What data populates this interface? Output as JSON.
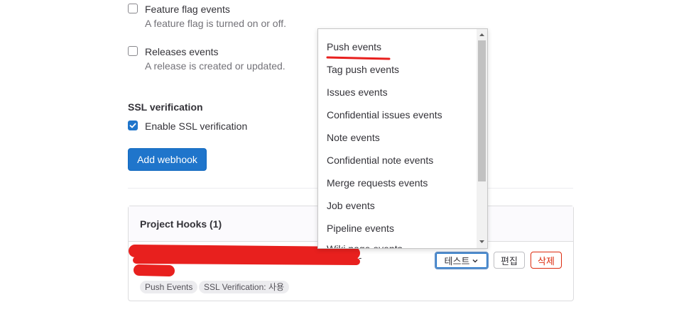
{
  "form": {
    "feature_flag": {
      "label": "Feature flag events",
      "help": "A feature flag is turned on or off.",
      "checked": false
    },
    "releases": {
      "label": "Releases events",
      "help": "A release is created or updated.",
      "checked": false
    },
    "ssl": {
      "title": "SSL verification",
      "label": "Enable SSL verification",
      "checked": true
    },
    "add_webhook_label": "Add webhook"
  },
  "hooks": {
    "header": "Project Hooks (1)",
    "row": {
      "url_suffix": "-",
      "badges": [
        "Push Events",
        "SSL Verification: 사용"
      ],
      "test_label": "테스트",
      "edit_label": "편집",
      "delete_label": "삭제"
    }
  },
  "dropdown": {
    "items": [
      "Push events",
      "Tag push events",
      "Issues events",
      "Confidential issues events",
      "Note events",
      "Confidential note events",
      "Merge requests events",
      "Job events",
      "Pipeline events",
      "Wiki page events"
    ]
  },
  "colors": {
    "primary": "#1f75cb",
    "danger": "#dd2b0e",
    "annotation": "#e8201e"
  },
  "icons": [
    "checkbox-check-icon",
    "chevron-down-icon",
    "scroll-up-arrow-icon",
    "scroll-down-arrow-icon"
  ]
}
